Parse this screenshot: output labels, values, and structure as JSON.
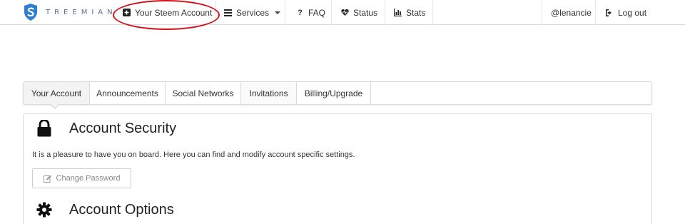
{
  "brand": {
    "name": "TREEMIAN",
    "logo_icon": "shield-s-logo"
  },
  "nav": {
    "items": [
      {
        "label": "Your Steem Account",
        "icon": "plus-square-icon"
      },
      {
        "label": "Services",
        "icon": "list-icon"
      },
      {
        "label": "FAQ",
        "icon": "question-icon"
      },
      {
        "label": "Status",
        "icon": "heartbeat-icon"
      },
      {
        "label": "Stats",
        "icon": "bar-chart-icon"
      }
    ],
    "user": "@lenancie",
    "logout": {
      "label": "Log out",
      "icon": "logout-icon"
    }
  },
  "tabs": [
    {
      "label": "Your Account",
      "active": true
    },
    {
      "label": "Announcements"
    },
    {
      "label": "Social Networks"
    },
    {
      "label": "Invitations"
    },
    {
      "label": "Billing/Upgrade"
    }
  ],
  "security": {
    "title": "Account Security",
    "icon": "lock-icon",
    "description": "It is a pleasure to have you on board. Here you can find and modify account specific settings.",
    "change_password": {
      "label": "Change Password",
      "icon": "edit-icon"
    }
  },
  "options": {
    "title": "Account Options",
    "icon": "gear-icon"
  },
  "colors": {
    "annotation": "#d0101a",
    "brand_text": "#5a6e8c",
    "logo_blue": "#2f7fd1"
  }
}
